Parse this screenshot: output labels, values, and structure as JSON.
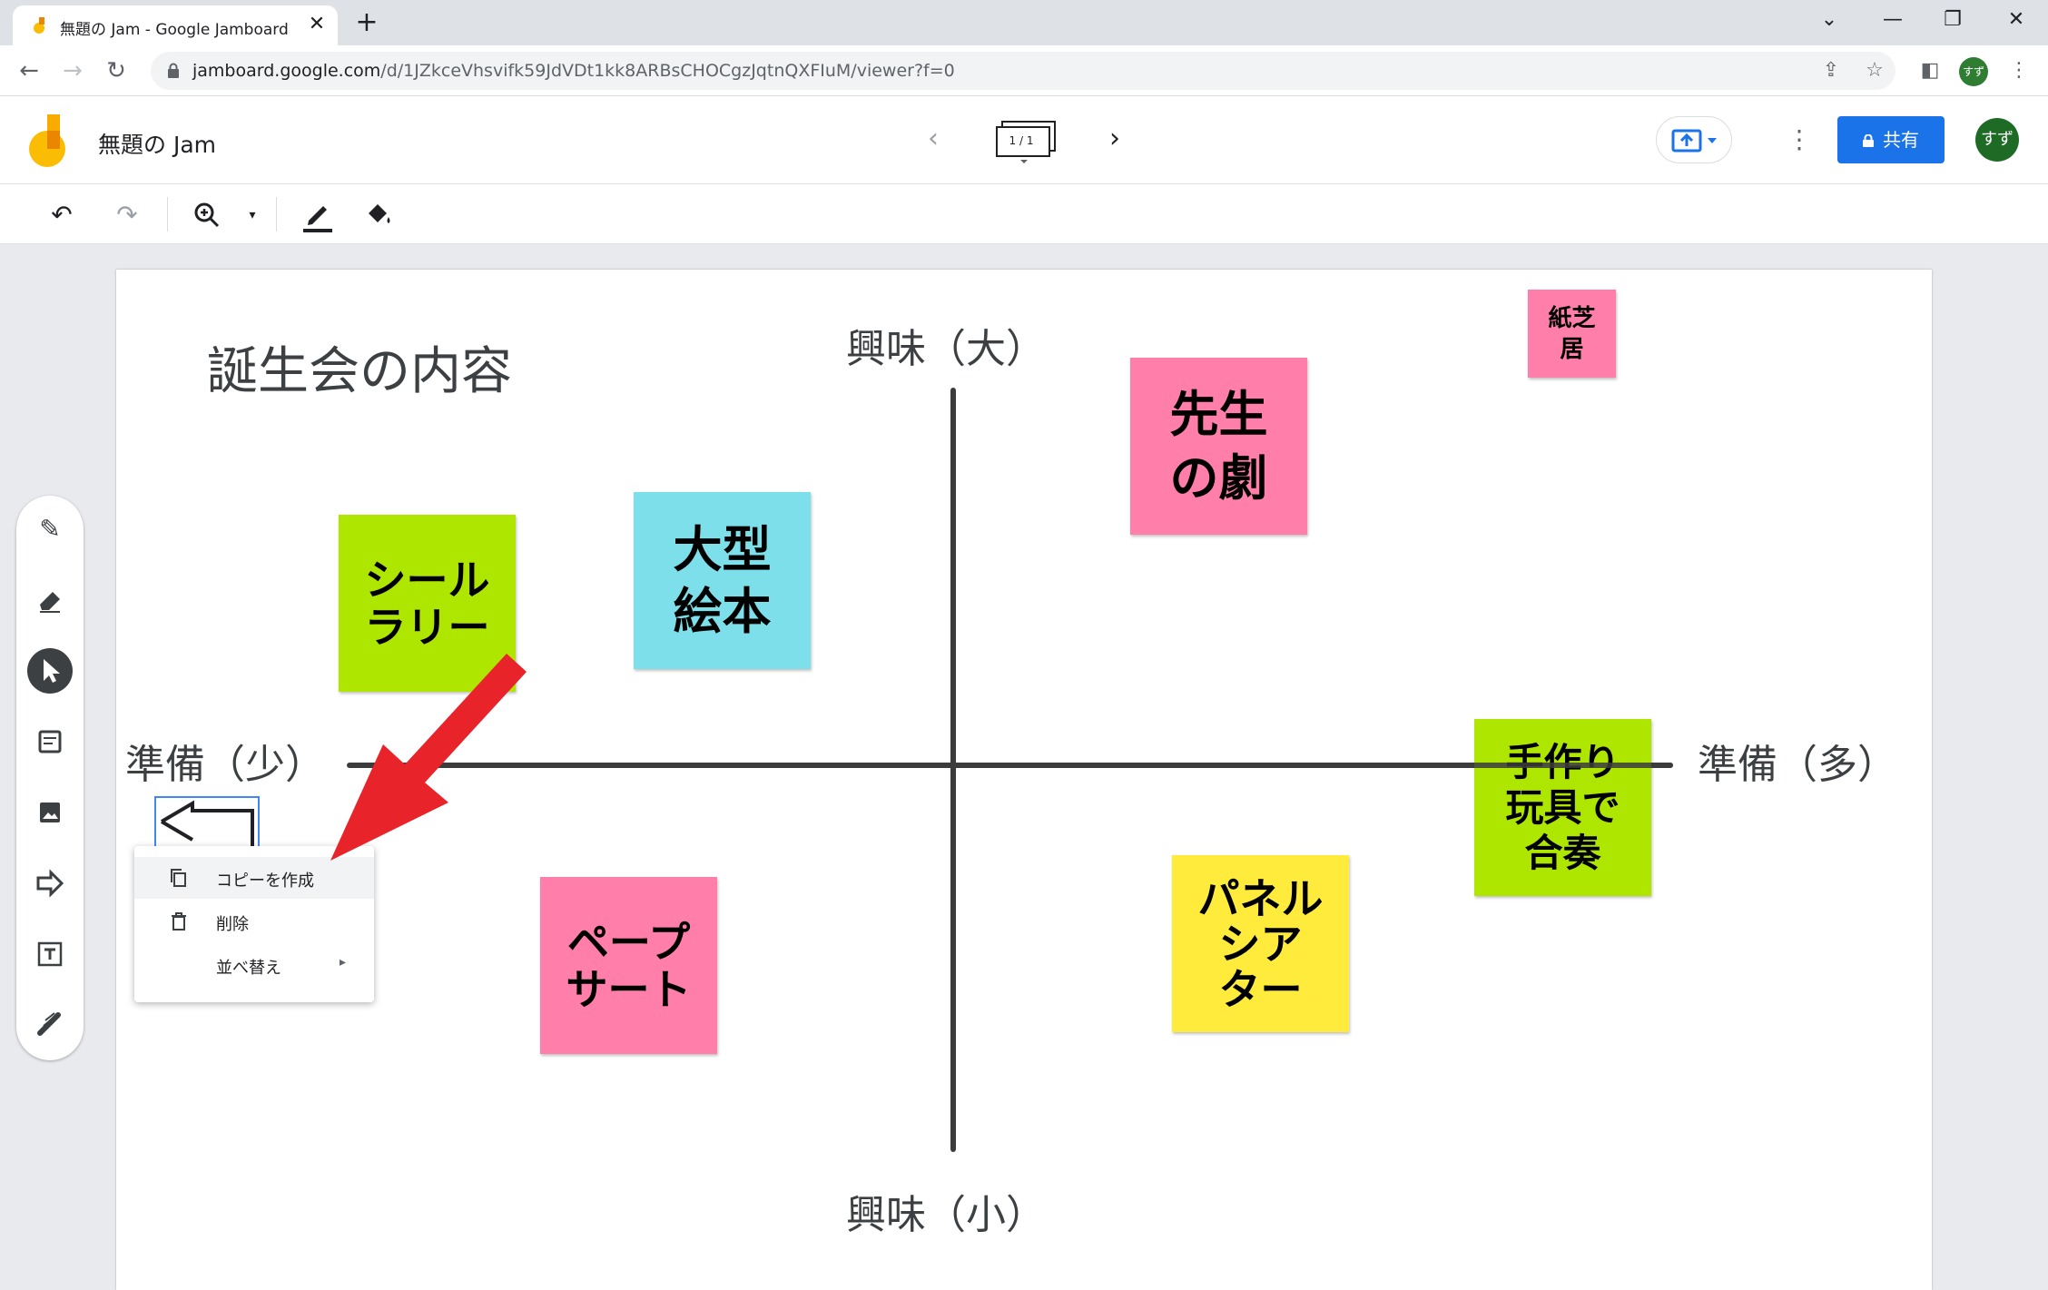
{
  "browser": {
    "tab_title": "無題の Jam - Google Jamboard",
    "new_tab": "+",
    "close": "✕",
    "url_host": "jamboard.google.com",
    "url_path": "/d/1JZkceVhsvifk59JdVDt1kk8ARBsCHOCgzJqtnQXFIuM/viewer?f=0",
    "profile_initials": "すず",
    "window_controls": [
      "⌄",
      "—",
      "❐",
      "✕"
    ]
  },
  "header": {
    "title": "無題の Jam",
    "frame_count": "1 / 1",
    "share_label": "共有",
    "avatar_initials": "すず"
  },
  "board": {
    "title": "誕生会の内容",
    "axis_top": "興味（大）",
    "axis_bottom": "興味（小）",
    "axis_left": "準備（少）",
    "axis_right": "準備（多）"
  },
  "notes": [
    {
      "id": "seal",
      "text": "シール\nラリー",
      "color": "#aee600"
    },
    {
      "id": "picturebook",
      "text": "大型\n絵本",
      "color": "#7ddfe9"
    },
    {
      "id": "teacher",
      "text": "先生\nの劇",
      "color": "#ff7eaa"
    },
    {
      "id": "kamishibai",
      "text": "紙芝\n居",
      "color": "#ff7eaa"
    },
    {
      "id": "handmade",
      "text": "手作り\n玩具で\n合奏",
      "color": "#aee600"
    },
    {
      "id": "puppet",
      "text": "ペープ\nサート",
      "color": "#ff7eaa"
    },
    {
      "id": "panel",
      "text": "パネル\nシア\nター",
      "color": "#ffeb3b"
    }
  ],
  "context_menu": {
    "copy": "コピーを作成",
    "delete": "削除",
    "order": "並べ替え",
    "submenu_arrow": "▸"
  },
  "colors": {
    "accent": "#1a73e8",
    "arrow": "#e8232a",
    "axis": "#3c3c3c"
  }
}
